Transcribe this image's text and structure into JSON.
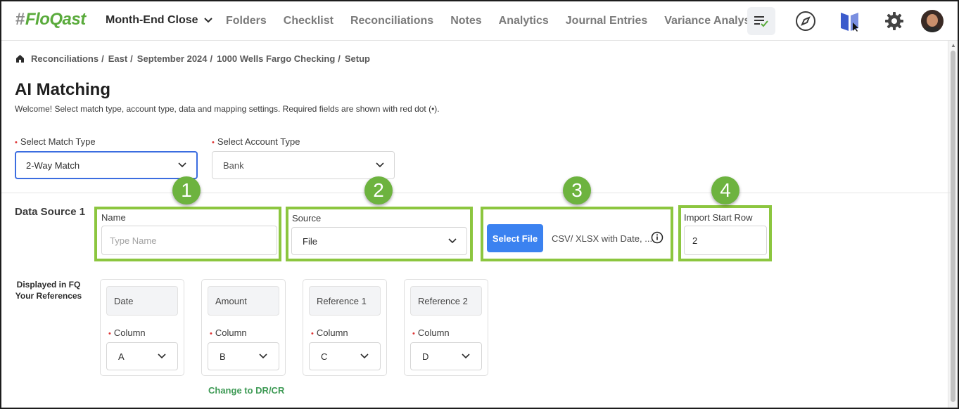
{
  "app": {
    "logo_hash": "#",
    "logo_text": "FloQast",
    "workspace_menu": "Month-End Close",
    "nav": [
      "Folders",
      "Checklist",
      "Reconciliations",
      "Notes",
      "Analytics",
      "Journal Entries",
      "Variance Analysis"
    ],
    "icons": [
      "tasks-icon",
      "compass-icon",
      "book-icon",
      "gear-icon",
      "avatar"
    ]
  },
  "breadcrumb": [
    "Reconciliations",
    "East",
    "September 2024",
    "1000 Wells Fargo Checking",
    "Setup"
  ],
  "breadcrumb_sep": "/",
  "page": {
    "title": "AI Matching",
    "subtitle": "Welcome! Select match type, account type, data and mapping settings. Required fields are shown with red dot (•)."
  },
  "required_dot": "•",
  "match_type": {
    "label": "Select Match Type",
    "value": "2-Way Match"
  },
  "account_type": {
    "label": "Select Account Type",
    "value": "Bank"
  },
  "data_source": {
    "title": "Data Source 1",
    "name_label": "Name",
    "name_placeholder": "Type Name",
    "source_label": "Source",
    "source_value": "File",
    "select_file_button": "Select File",
    "file_hint": "CSV/ XLSX with Date, ...",
    "import_label": "Import Start Row",
    "import_value": "2"
  },
  "callouts": [
    "1",
    "2",
    "3",
    "4"
  ],
  "references": {
    "label_line1": "Displayed in FQ",
    "label_line2": "Your References",
    "column_label": "Column",
    "cards": [
      {
        "field": "Date",
        "column": "A"
      },
      {
        "field": "Amount",
        "column": "B"
      },
      {
        "field": "Reference 1",
        "column": "C"
      },
      {
        "field": "Reference 2",
        "column": "D"
      }
    ],
    "change_link": "Change to DR/CR"
  },
  "colors": {
    "brand_green": "#5aab3c",
    "highlight_green": "#8cc63f",
    "primary_blue": "#3b82f0",
    "link_green": "#3e9a55",
    "required_red": "#dd3333"
  }
}
